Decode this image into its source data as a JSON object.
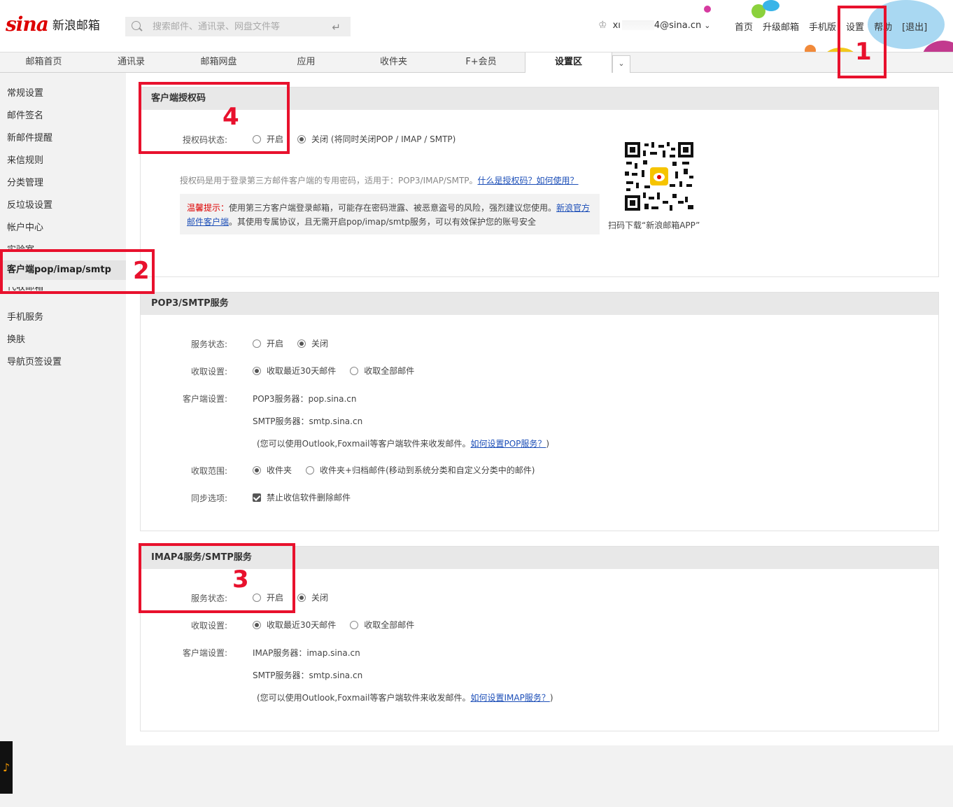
{
  "header": {
    "logo_mark": "sina",
    "logo_text": "新浪邮箱",
    "search_placeholder": "搜索邮件、通讯录、网盘文件等",
    "user_prefix": "xı",
    "user_suffix": "4@sina.cn",
    "nav": [
      "首页",
      "升级邮箱",
      "手机版",
      "设置",
      "帮助",
      "[退出]"
    ]
  },
  "tabs": [
    "邮箱首页",
    "通讯录",
    "邮箱网盘",
    "应用",
    "收件夹",
    "F+会员",
    "设置区"
  ],
  "sidebar": {
    "items": [
      "常规设置",
      "邮件签名",
      "新邮件提醒",
      "来信规则",
      "分类管理",
      "反垃圾设置",
      "帐户中心",
      "实验室",
      "客户端pop/imap/smtp",
      "代收邮箱",
      "手机服务",
      "换肤",
      "导航页签设置"
    ],
    "active": "客户端pop/imap/smtp"
  },
  "auth_panel": {
    "title": "客户端授权码",
    "status_label": "授权码状态:",
    "opt_on": "开启",
    "opt_off": "关闭 (将同时关闭POP / IMAP / SMTP)",
    "desc": "授权码是用于登录第三方邮件客户端的专用密码，适用于：POP3/IMAP/SMTP。",
    "desc_link": "什么是授权码？如何使用？",
    "warn_title": "温馨提示：",
    "warn_text1": "使用第三方客户端登录邮箱，可能存在密码泄露、被恶意盗号的风险，强烈建议您使用。",
    "warn_link": "新浪官方邮件客户端",
    "warn_text2": "。其使用专属协议，且无需开启pop/imap/smtp服务，可以有效保护您的账号安全",
    "qr_caption": "扫码下载“新浪邮箱APP”"
  },
  "pop_panel": {
    "title": "POP3/SMTP服务",
    "status_label": "服务状态:",
    "opt_on": "开启",
    "opt_off": "关闭",
    "fetch_label": "收取设置:",
    "fetch_30": "收取最近30天邮件",
    "fetch_all": "收取全部邮件",
    "client_label": "客户端设置:",
    "pop_server": "POP3服务器：pop.sina.cn",
    "smtp_server": "SMTP服务器：smtp.sina.cn",
    "hint_text": "(您可以使用Outlook,Foxmail等客户端软件来收发邮件。",
    "hint_link": "如何设置POP服务？",
    "hint_end": ")",
    "range_label": "收取范围:",
    "range_inbox": "收件夹",
    "range_all": "收件夹+归档邮件(移动到系统分类和自定义分类中的邮件)",
    "sync_label": "同步选项:",
    "sync_opt": "禁止收信软件删除邮件"
  },
  "imap_panel": {
    "title": "IMAP4服务/SMTP服务",
    "status_label": "服务状态:",
    "opt_on": "开启",
    "opt_off": "关闭",
    "fetch_label": "收取设置:",
    "fetch_30": "收取最近30天邮件",
    "fetch_all": "收取全部邮件",
    "client_label": "客户端设置:",
    "imap_server": "IMAP服务器：imap.sina.cn",
    "smtp_server": "SMTP服务器：smtp.sina.cn",
    "hint_text": "(您可以使用Outlook,Foxmail等客户端软件来收发邮件。",
    "hint_link": "如何设置IMAP服务？",
    "hint_end": ")"
  },
  "annotations": [
    "1",
    "2",
    "3",
    "4"
  ],
  "colors": {
    "annotation": "#e8112d",
    "brand": "#dd0000",
    "link": "#1d4fb8"
  }
}
